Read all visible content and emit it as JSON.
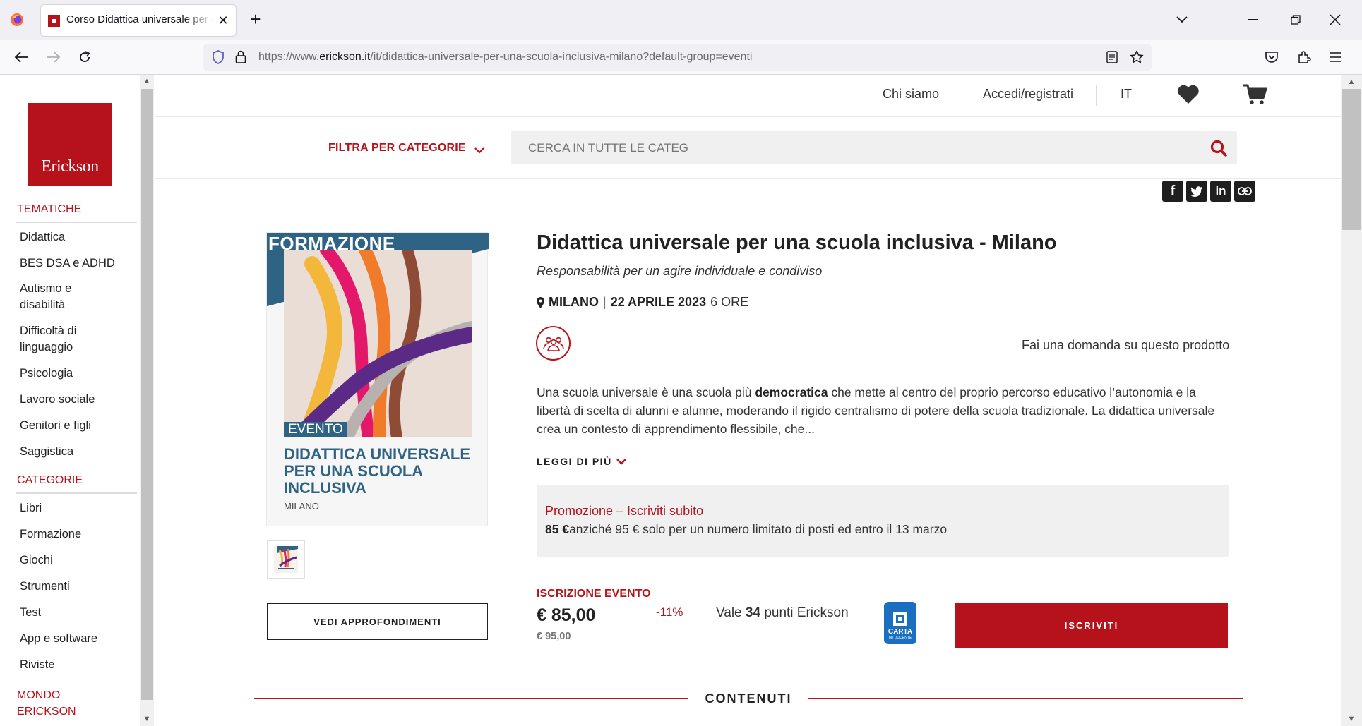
{
  "browser": {
    "tab_title": "Corso Didattica universale per una scuola inclusiva",
    "url_prefix": "https://www.",
    "url_domain": "erickson.it",
    "url_path": "/it/didattica-universale-per-una-scuola-inclusiva-milano?default-group=eventi"
  },
  "sidebar": {
    "logo_text": "Erickson",
    "tematiche_heading": "TEMATICHE",
    "tematiche": [
      "Didattica",
      "BES DSA e ADHD",
      "Autismo e disabilità",
      "Difficoltà di linguaggio",
      "Psicologia",
      "Lavoro sociale",
      "Genitori e figli",
      "Saggistica"
    ],
    "categorie_heading": "CATEGORIE",
    "categorie": [
      "Libri",
      "Formazione",
      "Giochi",
      "Strumenti",
      "Test",
      "App e software",
      "Riviste"
    ],
    "mondo_heading": "MONDO ERICKSON"
  },
  "header": {
    "chi_siamo": "Chi siamo",
    "accedi": "Accedi/registrati",
    "lang": "IT",
    "filter_label": "FILTRA PER CATEGORIE",
    "search_placeholder": "CERCA IN TUTTE LE CATEG"
  },
  "cover": {
    "banner": "FORMAZIONE",
    "tag": "EVENTO",
    "title": "DIDATTICA UNIVERSALE PER UNA SCUOLA INCLUSIVA",
    "city": "MILANO"
  },
  "product": {
    "title": "Didattica universale per una scuola inclusiva - Milano",
    "subtitle": "Responsabilità per un agire individuale e condiviso",
    "city": "MILANO",
    "date": "22 APRILE 2023",
    "duration": "6 ORE",
    "ask_question": "Fai una domanda su questo prodotto",
    "desc_before": "Una scuola universale è una scuola più ",
    "desc_bold": "democratica",
    "desc_after": " che mette al centro del proprio percorso educativo l’autonomia e la libertà di scelta di alunni e alunne, moderando il rigido centralismo di potere della scuola tradizionale. La didattica universale crea un contesto di apprendimento flessibile, che...",
    "read_more": "LEGGI DI PIÙ",
    "promo_title": "Promozione – Iscriviti subito",
    "promo_price": "85 €",
    "promo_text": "anziché 95 € solo per un numero limitato di posti ed entro il 13 marzo",
    "vedi_button": "VEDI APPROFONDIMENTI",
    "iscrizione_label": "ISCRIZIONE EVENTO",
    "price": "€ 85,00",
    "old_price": "€ 95,00",
    "discount": "-11%",
    "points_before": "Vale ",
    "points_value": "34",
    "points_after": " punti Erickson",
    "carta_line1": "CARTA",
    "carta_line2": "del DOCENTE",
    "iscriviti_button": "ISCRIVITI",
    "contenuti_heading": "CONTENUTI"
  },
  "colors": {
    "brand_red": "#b5121b",
    "cover_blue": "#2e6384"
  }
}
